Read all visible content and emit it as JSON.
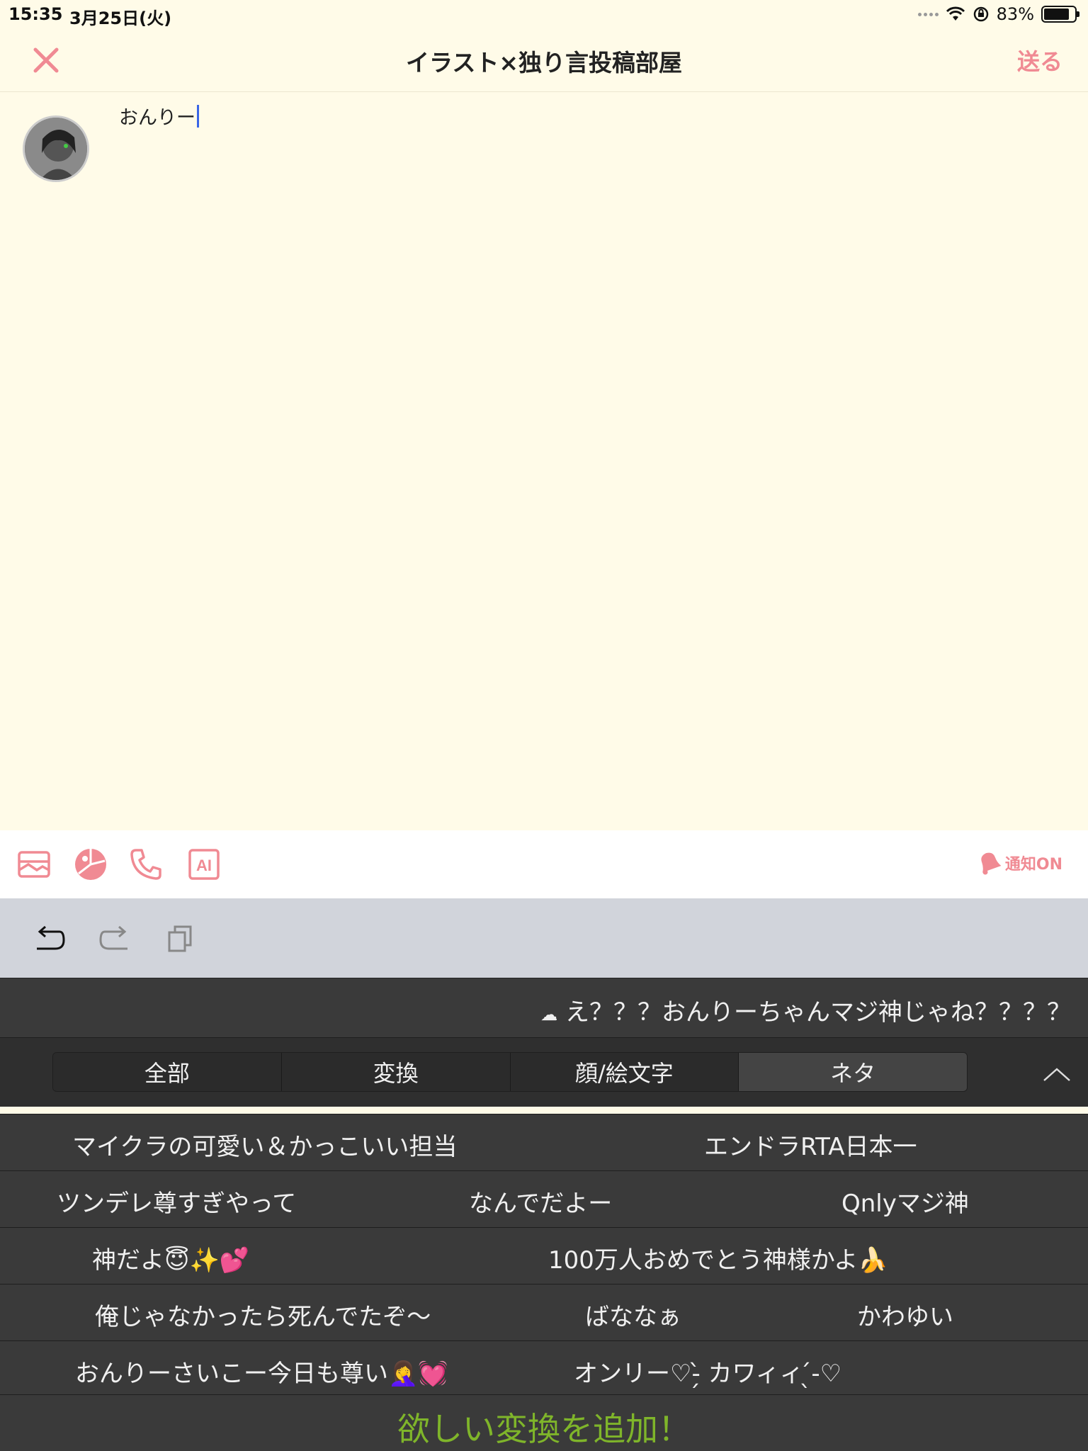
{
  "status_bar": {
    "time": "15:35",
    "date": "3月25日(火)",
    "battery": "83%"
  },
  "header": {
    "title": "イラスト×独り言投稿部屋",
    "send_label": "送る",
    "close_icon": "close-icon"
  },
  "compose": {
    "text": "おんりー"
  },
  "toolbar": {
    "icons": [
      "image-icon",
      "pie-chart-icon",
      "phone-icon",
      "ai-icon"
    ],
    "ai_label": "AI",
    "notify_label": "通知ON"
  },
  "keyboard": {
    "shortcut_icons": [
      "undo-icon",
      "redo-icon",
      "paste-icon"
    ],
    "candidate": "え？？？おんりーちゃんマジ神じゃね？？？？",
    "tabs": [
      "全部",
      "変換",
      "顔/絵文字",
      "ネタ"
    ],
    "active_tab": "ネタ",
    "rows": [
      [
        "マイクラの可愛い＆かっこいい担当",
        "エンドラRTA日本一"
      ],
      [
        "ツンデレ尊すぎやって",
        "なんでだよー",
        "Qnlyマジ神"
      ],
      [
        "神だよ😇✨💕",
        "100万人おめでとう神様かよ🍌"
      ],
      [
        "俺じゃなかったら死んでたぞ〜",
        "ばななぁ",
        "かわゆい"
      ],
      [
        "おんりーさいこー今日も尊い🤦‍♀️💓",
        "オンリー♡-̗̀ カワィィ ̖́-♡"
      ]
    ],
    "add_label": "欲しい変換を追加！"
  },
  "colors": {
    "accent": "#f08a93",
    "background": "#fffbe8",
    "keyboard_bg": "#3a3a3a",
    "add_text": "#7fb52a"
  }
}
